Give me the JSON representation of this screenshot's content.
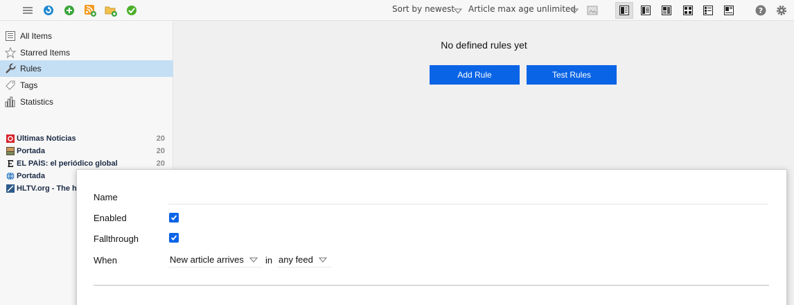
{
  "toolbar": {
    "sort_label": "Sort by newest",
    "age_label": "Article max age unlimited"
  },
  "sidebar": {
    "nav": [
      {
        "label": "All Items",
        "icon": "list-icon"
      },
      {
        "label": "Starred Items",
        "icon": "star-icon"
      },
      {
        "label": "Rules",
        "icon": "wrench-icon"
      },
      {
        "label": "Tags",
        "icon": "tag-icon"
      },
      {
        "label": "Statistics",
        "icon": "bar-chart-icon"
      }
    ],
    "feeds": [
      {
        "name": "Últimas Noticias",
        "count": "20",
        "icon": "red-square-feed-icon"
      },
      {
        "name": "Portada",
        "count": "20",
        "icon": "image-feed-icon"
      },
      {
        "name": "EL PAÍS: el periódico global",
        "count": "20",
        "icon": "letter-e-feed-icon"
      },
      {
        "name": "Portada",
        "count": "",
        "icon": "globe-feed-icon"
      },
      {
        "name": "HLTV.org - The h",
        "count": "",
        "icon": "blue-arrow-feed-icon"
      }
    ]
  },
  "main": {
    "empty_message": "No defined rules yet",
    "add_rule_label": "Add Rule",
    "test_rules_label": "Test Rules"
  },
  "dialog": {
    "name_label": "Name",
    "name_value": "",
    "enabled_label": "Enabled",
    "enabled_checked": true,
    "fallthrough_label": "Fallthrough",
    "fallthrough_checked": true,
    "when_label": "When",
    "when_value": "New article arrives",
    "in_label": "in",
    "feed_value": "any feed"
  },
  "colors": {
    "accent": "#0a64e6",
    "selected_row": "#c4def3"
  }
}
